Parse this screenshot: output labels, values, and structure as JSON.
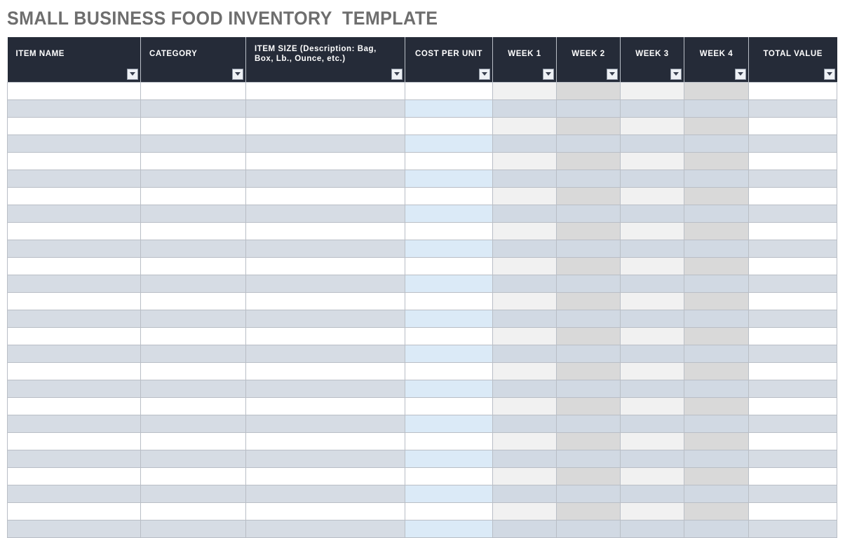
{
  "document": {
    "title": "SMALL BUSINESS FOOD INVENTORY  TEMPLATE"
  },
  "colors": {
    "header_background": "#252b38",
    "header_text": "#ffffff",
    "title_text": "#6e6e6e",
    "row_band": "#d6dce4",
    "row_white": "#ffffff",
    "cost_band": "#dbeaf7",
    "week_light": "#f1f1f1",
    "week_dark": "#d9d9d9",
    "week_band": "#d1d9e3",
    "grid_line": "#b9bec6"
  },
  "table": {
    "columns": [
      {
        "key": "item_name",
        "label": "ITEM NAME",
        "align": "left",
        "filter": true
      },
      {
        "key": "category",
        "label": "CATEGORY",
        "align": "left",
        "filter": true
      },
      {
        "key": "item_size",
        "label": "ITEM SIZE (Description: Bag, Box, Lb., Ounce, etc.)",
        "align": "left",
        "filter": true
      },
      {
        "key": "cost_per_unit",
        "label": "COST PER UNIT",
        "align": "center",
        "filter": true
      },
      {
        "key": "week_1",
        "label": "WEEK 1",
        "align": "center",
        "filter": true
      },
      {
        "key": "week_2",
        "label": "WEEK 2",
        "align": "center",
        "filter": true
      },
      {
        "key": "week_3",
        "label": "WEEK 3",
        "align": "center",
        "filter": true
      },
      {
        "key": "week_4",
        "label": "WEEK 4",
        "align": "center",
        "filter": true
      },
      {
        "key": "total_value",
        "label": "TOTAL VALUE",
        "align": "center",
        "filter": true
      }
    ],
    "filter_icon": "chevron-down-icon",
    "row_count": 26,
    "rows": [
      {
        "item_name": "",
        "category": "",
        "item_size": "",
        "cost_per_unit": "",
        "week_1": "",
        "week_2": "",
        "week_3": "",
        "week_4": "",
        "total_value": ""
      },
      {
        "item_name": "",
        "category": "",
        "item_size": "",
        "cost_per_unit": "",
        "week_1": "",
        "week_2": "",
        "week_3": "",
        "week_4": "",
        "total_value": ""
      },
      {
        "item_name": "",
        "category": "",
        "item_size": "",
        "cost_per_unit": "",
        "week_1": "",
        "week_2": "",
        "week_3": "",
        "week_4": "",
        "total_value": ""
      },
      {
        "item_name": "",
        "category": "",
        "item_size": "",
        "cost_per_unit": "",
        "week_1": "",
        "week_2": "",
        "week_3": "",
        "week_4": "",
        "total_value": ""
      },
      {
        "item_name": "",
        "category": "",
        "item_size": "",
        "cost_per_unit": "",
        "week_1": "",
        "week_2": "",
        "week_3": "",
        "week_4": "",
        "total_value": ""
      },
      {
        "item_name": "",
        "category": "",
        "item_size": "",
        "cost_per_unit": "",
        "week_1": "",
        "week_2": "",
        "week_3": "",
        "week_4": "",
        "total_value": ""
      },
      {
        "item_name": "",
        "category": "",
        "item_size": "",
        "cost_per_unit": "",
        "week_1": "",
        "week_2": "",
        "week_3": "",
        "week_4": "",
        "total_value": ""
      },
      {
        "item_name": "",
        "category": "",
        "item_size": "",
        "cost_per_unit": "",
        "week_1": "",
        "week_2": "",
        "week_3": "",
        "week_4": "",
        "total_value": ""
      },
      {
        "item_name": "",
        "category": "",
        "item_size": "",
        "cost_per_unit": "",
        "week_1": "",
        "week_2": "",
        "week_3": "",
        "week_4": "",
        "total_value": ""
      },
      {
        "item_name": "",
        "category": "",
        "item_size": "",
        "cost_per_unit": "",
        "week_1": "",
        "week_2": "",
        "week_3": "",
        "week_4": "",
        "total_value": ""
      },
      {
        "item_name": "",
        "category": "",
        "item_size": "",
        "cost_per_unit": "",
        "week_1": "",
        "week_2": "",
        "week_3": "",
        "week_4": "",
        "total_value": ""
      },
      {
        "item_name": "",
        "category": "",
        "item_size": "",
        "cost_per_unit": "",
        "week_1": "",
        "week_2": "",
        "week_3": "",
        "week_4": "",
        "total_value": ""
      },
      {
        "item_name": "",
        "category": "",
        "item_size": "",
        "cost_per_unit": "",
        "week_1": "",
        "week_2": "",
        "week_3": "",
        "week_4": "",
        "total_value": ""
      },
      {
        "item_name": "",
        "category": "",
        "item_size": "",
        "cost_per_unit": "",
        "week_1": "",
        "week_2": "",
        "week_3": "",
        "week_4": "",
        "total_value": ""
      },
      {
        "item_name": "",
        "category": "",
        "item_size": "",
        "cost_per_unit": "",
        "week_1": "",
        "week_2": "",
        "week_3": "",
        "week_4": "",
        "total_value": ""
      },
      {
        "item_name": "",
        "category": "",
        "item_size": "",
        "cost_per_unit": "",
        "week_1": "",
        "week_2": "",
        "week_3": "",
        "week_4": "",
        "total_value": ""
      },
      {
        "item_name": "",
        "category": "",
        "item_size": "",
        "cost_per_unit": "",
        "week_1": "",
        "week_2": "",
        "week_3": "",
        "week_4": "",
        "total_value": ""
      },
      {
        "item_name": "",
        "category": "",
        "item_size": "",
        "cost_per_unit": "",
        "week_1": "",
        "week_2": "",
        "week_3": "",
        "week_4": "",
        "total_value": ""
      },
      {
        "item_name": "",
        "category": "",
        "item_size": "",
        "cost_per_unit": "",
        "week_1": "",
        "week_2": "",
        "week_3": "",
        "week_4": "",
        "total_value": ""
      },
      {
        "item_name": "",
        "category": "",
        "item_size": "",
        "cost_per_unit": "",
        "week_1": "",
        "week_2": "",
        "week_3": "",
        "week_4": "",
        "total_value": ""
      },
      {
        "item_name": "",
        "category": "",
        "item_size": "",
        "cost_per_unit": "",
        "week_1": "",
        "week_2": "",
        "week_3": "",
        "week_4": "",
        "total_value": ""
      },
      {
        "item_name": "",
        "category": "",
        "item_size": "",
        "cost_per_unit": "",
        "week_1": "",
        "week_2": "",
        "week_3": "",
        "week_4": "",
        "total_value": ""
      },
      {
        "item_name": "",
        "category": "",
        "item_size": "",
        "cost_per_unit": "",
        "week_1": "",
        "week_2": "",
        "week_3": "",
        "week_4": "",
        "total_value": ""
      },
      {
        "item_name": "",
        "category": "",
        "item_size": "",
        "cost_per_unit": "",
        "week_1": "",
        "week_2": "",
        "week_3": "",
        "week_4": "",
        "total_value": ""
      },
      {
        "item_name": "",
        "category": "",
        "item_size": "",
        "cost_per_unit": "",
        "week_1": "",
        "week_2": "",
        "week_3": "",
        "week_4": "",
        "total_value": ""
      },
      {
        "item_name": "",
        "category": "",
        "item_size": "",
        "cost_per_unit": "",
        "week_1": "",
        "week_2": "",
        "week_3": "",
        "week_4": "",
        "total_value": ""
      }
    ]
  }
}
